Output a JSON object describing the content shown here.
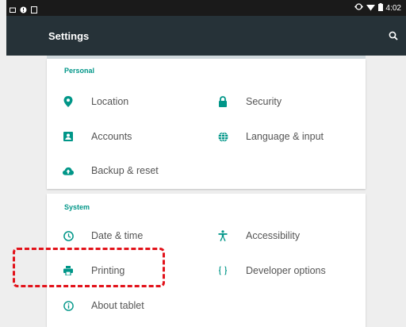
{
  "status_bar": {
    "time": "4:02",
    "left_icons": [
      "notification-icon",
      "alert-circle-icon",
      "sd-card-icon"
    ],
    "right_icons": [
      "data-sync-icon",
      "wifi-icon",
      "battery-icon"
    ]
  },
  "app_bar": {
    "title": "Settings",
    "search_icon": "search-icon"
  },
  "sections": {
    "personal": {
      "title": "Personal",
      "items": [
        {
          "label": "Location",
          "icon": "location-pin-icon"
        },
        {
          "label": "Security",
          "icon": "lock-icon"
        },
        {
          "label": "Accounts",
          "icon": "account-box-icon"
        },
        {
          "label": "Language & input",
          "icon": "globe-icon"
        },
        {
          "label": "Backup & reset",
          "icon": "cloud-upload-icon"
        }
      ]
    },
    "system": {
      "title": "System",
      "items": [
        {
          "label": "Date & time",
          "icon": "clock-icon"
        },
        {
          "label": "Accessibility",
          "icon": "accessibility-icon"
        },
        {
          "label": "Printing",
          "icon": "printer-icon"
        },
        {
          "label": "Developer options",
          "icon": "code-braces-icon"
        },
        {
          "label": "About tablet",
          "icon": "info-icon"
        }
      ]
    }
  },
  "colors": {
    "accent": "#009688",
    "app_bar": "#263238",
    "status_bar": "#1a1a1a",
    "highlight_dash": "#e2121a"
  }
}
